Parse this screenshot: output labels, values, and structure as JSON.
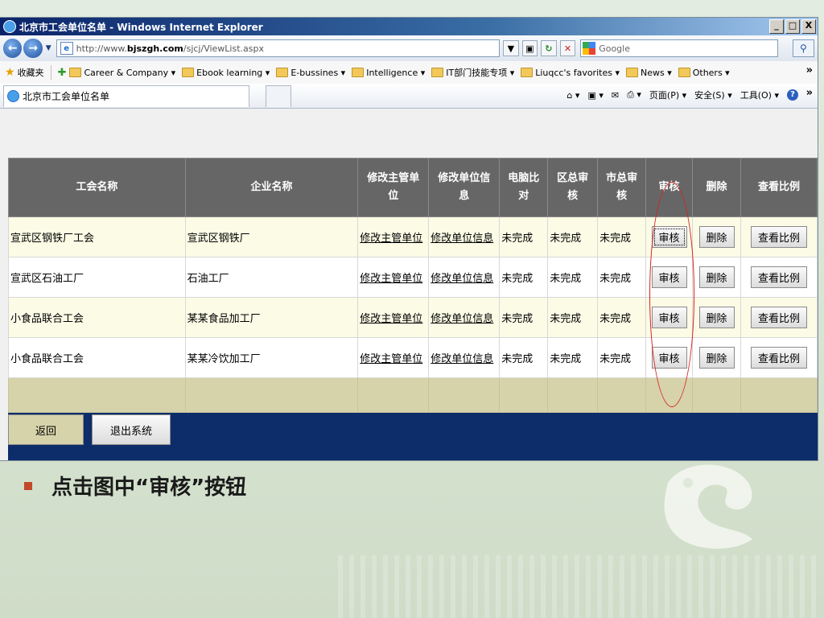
{
  "window": {
    "title": "北京市工会单位名单 - Windows Internet Explorer",
    "controls": [
      "_",
      "□",
      "X"
    ]
  },
  "addressbar": {
    "url_prefix": "http://www.",
    "url_domain": "bjszgh.com",
    "url_path": "/sjcj/ViewList.aspx",
    "search_placeholder": "Google"
  },
  "favorites": {
    "label": "收藏夹",
    "items": [
      "Career & Company ▾",
      "Ebook learning ▾",
      "E-bussines ▾",
      "Intelligence ▾",
      "IT部门技能专项 ▾",
      "Liuqcc's favorites ▾",
      "News ▾",
      "Others ▾"
    ],
    "chevron": "»"
  },
  "tab": {
    "title": "北京市工会单位名单"
  },
  "commandbar": {
    "page": "页面(P) ▾",
    "safety": "安全(S) ▾",
    "tools": "工具(O) ▾",
    "chevron": "»"
  },
  "table": {
    "headers": {
      "union_name": "工会名称",
      "company_name": "企业名称",
      "edit_unit_a": "修改主管单",
      "edit_unit_b": "位",
      "edit_info_a": "修改单位信",
      "edit_info_b": "息",
      "compare_a": "电脑比",
      "compare_b": "对",
      "district_a": "区总审",
      "district_b": "核",
      "city_a": "市总审",
      "city_b": "核",
      "audit": "审核",
      "delete": "删除",
      "ratio": "查看比例"
    },
    "rows": [
      {
        "union": "宣武区钢铁厂工会",
        "company": "宣武区钢铁厂",
        "edit_unit": "修改主管单位",
        "edit_info": "修改单位信息",
        "compare": "未完成",
        "district": "未完成",
        "city": "未完成",
        "audit": "审核",
        "delete": "删除",
        "ratio": "查看比例"
      },
      {
        "union": "宣武区石油工厂",
        "company": "石油工厂",
        "edit_unit": "修改主管单位",
        "edit_info": "修改单位信息",
        "compare": "未完成",
        "district": "未完成",
        "city": "未完成",
        "audit": "审核",
        "delete": "删除",
        "ratio": "查看比例"
      },
      {
        "union": "小食品联合工会",
        "company": "某某食品加工厂",
        "edit_unit": "修改主管单位",
        "edit_info": "修改单位信息",
        "compare": "未完成",
        "district": "未完成",
        "city": "未完成",
        "audit": "审核",
        "delete": "删除",
        "ratio": "查看比例"
      },
      {
        "union": "小食品联合工会",
        "company": "某某冷饮加工厂",
        "edit_unit": "修改主管单位",
        "edit_info": "修改单位信息",
        "compare": "未完成",
        "district": "未完成",
        "city": "未完成",
        "audit": "审核",
        "delete": "删除",
        "ratio": "查看比例"
      }
    ]
  },
  "footer_buttons": {
    "back": "返回",
    "exit": "退出系统"
  },
  "slide": {
    "caption": "点击图中“审核”按钮"
  },
  "colors": {
    "header_bg": "#666666",
    "content_bg": "#0d2d6a",
    "annotation": "#d82020",
    "bullet": "#c24a2a"
  }
}
